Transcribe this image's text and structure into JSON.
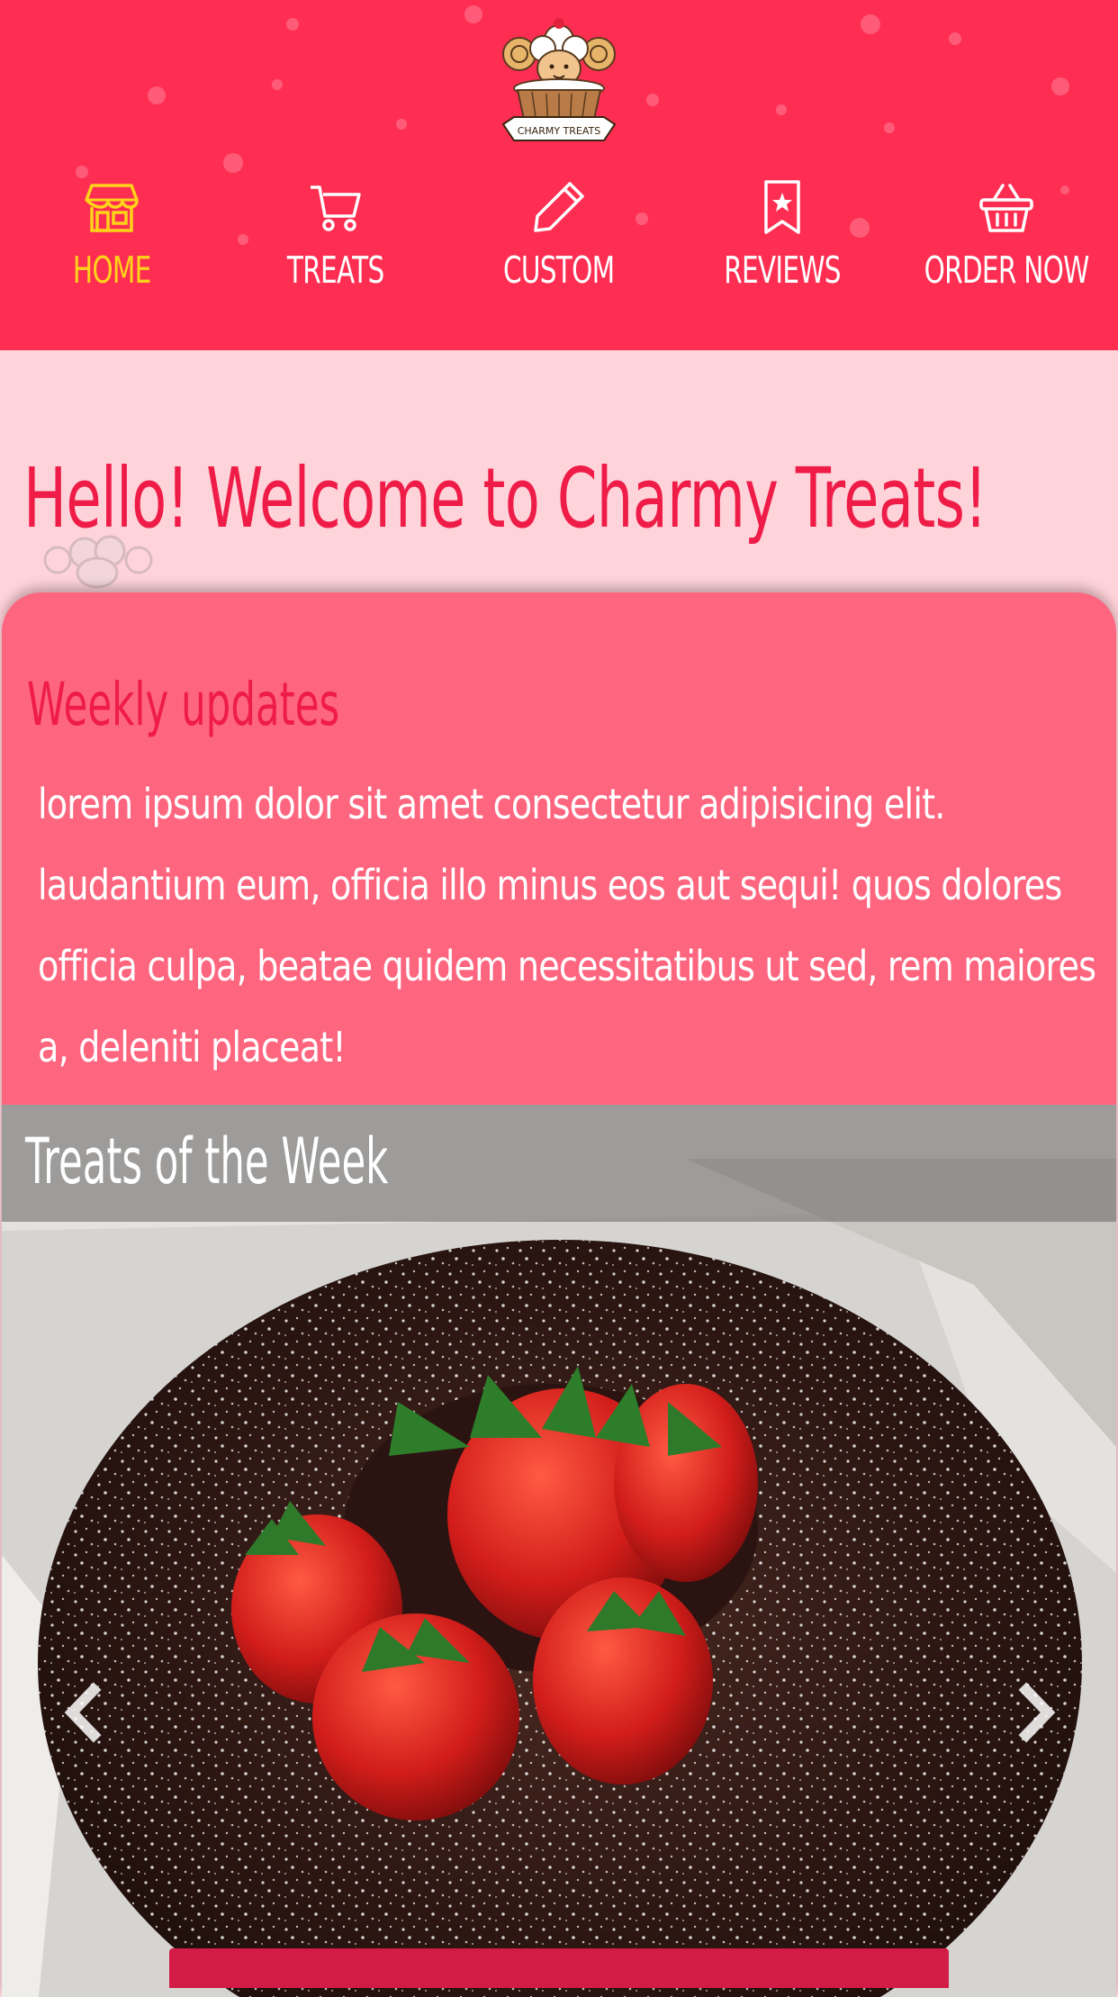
{
  "brand": {
    "logo_text": "CHARMY TREATS",
    "primary_color": "#fe2e52",
    "accent_color": "#ffd31a",
    "page_bg": "#ffd3da",
    "card_color": "#fe6680"
  },
  "nav": {
    "items": [
      {
        "label": "HOME",
        "icon": "store-icon",
        "active": true
      },
      {
        "label": "TREATS",
        "icon": "cart-icon",
        "active": false
      },
      {
        "label": "CUSTOM",
        "icon": "pencil-icon",
        "active": false
      },
      {
        "label": "REVIEWS",
        "icon": "bookmark-star-icon",
        "active": false
      },
      {
        "label": "ORDER NOW",
        "icon": "basket-icon",
        "active": false
      }
    ]
  },
  "main": {
    "welcome_title": "Hello! Welcome to Charmy Treats!",
    "updates": {
      "title": "Weekly updates",
      "body": "Lorem ipsum dolor sit amet consectetur adipisicing elit. Laudantium eum, officia illo minus eos aut sequi! Quos dolores officia culpa, beatae quidem necessitatibus ut sed, rem maiores a, deleniti placeat!"
    },
    "carousel": {
      "caption": "Treats of the Week",
      "prev_icon": "chevron-left-icon",
      "next_icon": "chevron-right-icon"
    }
  }
}
